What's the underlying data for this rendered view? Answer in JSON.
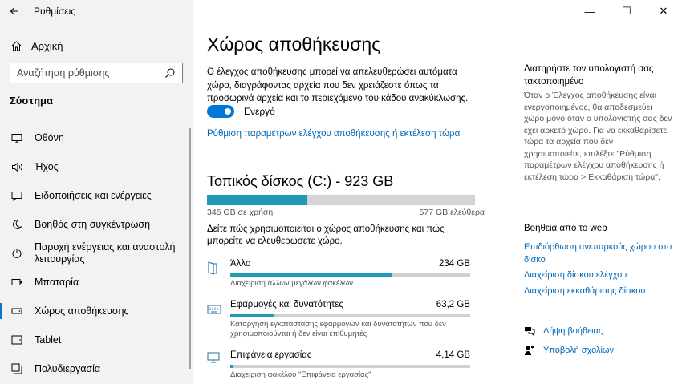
{
  "window": {
    "app_title": "Ρυθμίσεις",
    "controls": [
      "—",
      "☐",
      "✕"
    ]
  },
  "sidebar": {
    "home_label": "Αρχική",
    "search_placeholder": "Αναζήτηση ρύθμισης",
    "section_title": "Σύστημα",
    "items": [
      {
        "label": "Οθόνη",
        "icon": "monitor-icon"
      },
      {
        "label": "Ήχος",
        "icon": "speaker-icon"
      },
      {
        "label": "Ειδοποιήσεις και ενέργειες",
        "icon": "notification-icon"
      },
      {
        "label": "Βοηθός στη συγκέντρωση",
        "icon": "moon-icon"
      },
      {
        "label": "Παροχή ενέργειας και αναστολή λειτουργίας",
        "icon": "power-icon"
      },
      {
        "label": "Μπαταρία",
        "icon": "battery-icon"
      },
      {
        "label": "Χώρος αποθήκευσης",
        "icon": "storage-icon",
        "active": true
      },
      {
        "label": "Tablet",
        "icon": "tablet-icon"
      },
      {
        "label": "Πολυδιεργασία",
        "icon": "multitasking-icon"
      }
    ]
  },
  "main": {
    "title": "Χώρος αποθήκευσης",
    "description": "Ο έλεγχος αποθήκευσης μπορεί να απελευθερώσει αυτόματα χώρο, διαγράφοντας αρχεία που δεν χρειάζεστε όπως τα προσωρινά αρχεία και το περιεχόμενο του κάδου ανακύκλωσης.",
    "toggle_label": "Ενεργό",
    "toggle_on": true,
    "config_link": "Ρύθμιση παραμέτρων ελέγχου αποθήκευσης ή εκτέλεση τώρα",
    "disk_title": "Τοπικός δίσκος (C:) - 923 GB",
    "disk_used_fraction": 0.375,
    "used_label": "346 GB σε χρήση",
    "free_label": "577 GB ελεύθερα",
    "disk_description": "Δείτε πώς χρησιμοποιείται ο χώρος αποθήκευσης και πώς μπορείτε να ελευθερώσετε χώρο.",
    "categories": [
      {
        "name": "Άλλο",
        "size": "234 GB",
        "fraction": 0.676,
        "desc": "Διαχείριση άλλων μεγάλων φακέλων",
        "icon": "folder-icon"
      },
      {
        "name": "Εφαρμογές και δυνατότητες",
        "size": "63,2 GB",
        "fraction": 0.183,
        "desc": "Κατάργηση εγκατάστασης εφαρμογών και δυνατοτήτων που δεν χρησιμοποιούνται ή δεν είναι επιθυμητές",
        "icon": "keyboard-icon"
      },
      {
        "name": "Επιφάνεια εργασίας",
        "size": "4,14 GB",
        "fraction": 0.012,
        "desc": "Διαχείριση φακέλου \"Επιφάνεια εργασίας\"",
        "icon": "desktop-icon"
      }
    ]
  },
  "right": {
    "title": "Διατηρήστε τον υπολογιστή σας τακτοποιημένο",
    "text": "Όταν ο Έλεγχος αποθήκευσης είναι ενεργοποιημένος, θα αποδεσμεύει χώρο μόνο όταν ο υπολογιστής σας δεν έχει αρκετό χώρο. Για να εκκαθαρίσετε τώρα τα αρχεία που δεν χρησιμοποιείτε, επιλέξτε \"Ρύθμιση παραμέτρων ελέγχου αποθήκευσης ή εκτέλεση τώρα > Εκκαθάριση τώρα\".",
    "help_title": "Βοήθεια από το web",
    "links": [
      "Επιδιόρθωση ανεπαρκούς χώρου στο δίσκο",
      "Διαχείριση δίσκου ελέγχου",
      "Διαχείριση εκκαθάρισης δίσκου"
    ],
    "get_help": "Λήψη βοήθειας",
    "feedback": "Υποβολή σχολίων"
  },
  "colors": {
    "accent": "#0078d7",
    "bar_fill": "#1f9bb8",
    "link": "#0067b8"
  }
}
